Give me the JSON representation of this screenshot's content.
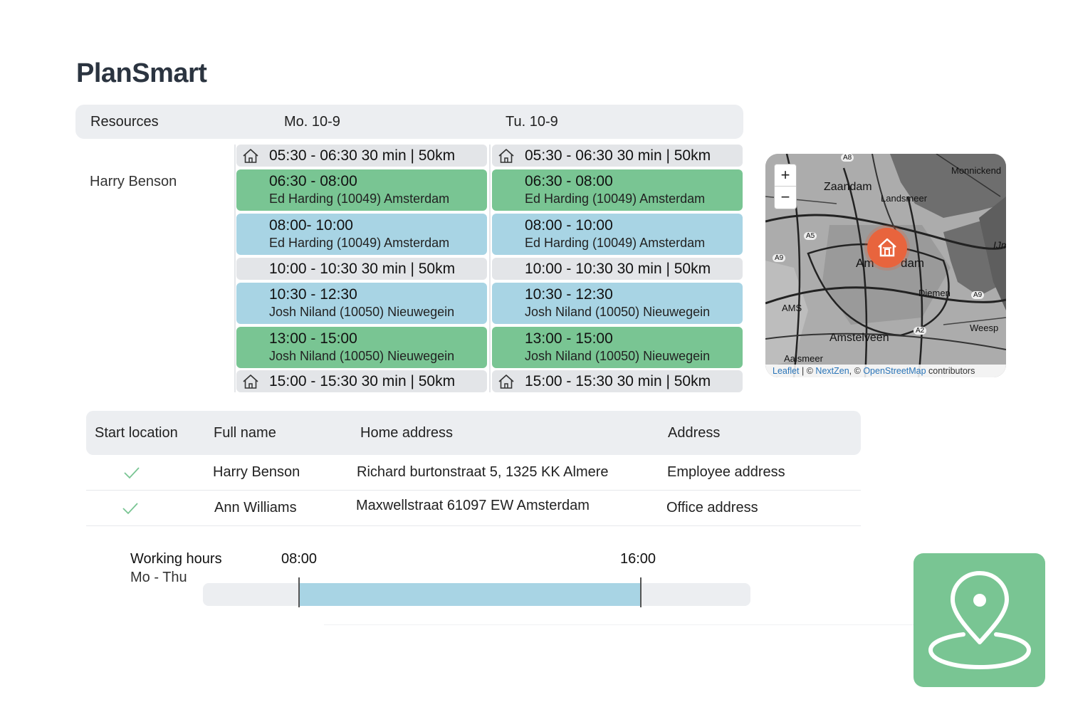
{
  "app": {
    "title": "PlanSmart"
  },
  "schedule": {
    "header": {
      "resources": "Resources",
      "day1": "Mo. 10-9",
      "day2": "Tu. 10-9"
    },
    "resource": "Harry Benson",
    "day1": [
      {
        "type": "travel",
        "home": true,
        "text": "05:30 - 06:30 30 min | 50km"
      },
      {
        "type": "green",
        "time": "06:30 - 08:00",
        "detail": "Ed Harding (10049) Amsterdam"
      },
      {
        "type": "blue",
        "time": "08:00- 10:00",
        "detail": "Ed Harding (10049) Amsterdam"
      },
      {
        "type": "travel",
        "home": false,
        "text": "10:00 - 10:30 30 min | 50km"
      },
      {
        "type": "blue",
        "time": "10:30 - 12:30",
        "detail": "Josh Niland (10050) Nieuwegein"
      },
      {
        "type": "green",
        "time": "13:00 - 15:00",
        "detail": "Josh Niland (10050) Nieuwegein"
      },
      {
        "type": "travel",
        "home": true,
        "text": "15:00 - 15:30 30 min | 50km"
      }
    ],
    "day2": [
      {
        "type": "travel",
        "home": true,
        "text": "05:30 - 06:30 30 min | 50km"
      },
      {
        "type": "green",
        "time": "06:30 - 08:00",
        "detail": "Ed Harding (10049) Amsterdam"
      },
      {
        "type": "blue",
        "time": "08:00 - 10:00",
        "detail": "Ed Harding (10049) Amsterdam"
      },
      {
        "type": "travel",
        "home": false,
        "text": "10:00 - 10:30 30 min | 50km"
      },
      {
        "type": "blue",
        "time": "10:30 - 12:30",
        "detail": "Josh Niland (10050) Nieuwegein"
      },
      {
        "type": "green",
        "time": "13:00 - 15:00",
        "detail": "Josh Niland (10050) Nieuwegein"
      },
      {
        "type": "travel",
        "home": true,
        "text": "15:00 - 15:30 30 min | 50km"
      }
    ]
  },
  "map": {
    "zoom_in": "+",
    "zoom_out": "−",
    "labels": {
      "zaandam": "Zaandam",
      "landsmeer": "Landsmeer",
      "monnickend": "Monnickend",
      "amsterdam_left": "Am",
      "amsterdam_right": "dam",
      "diemen": "Diemen",
      "ams": "AMS",
      "amstelveen": "Amstelveen",
      "weesp": "Weesp",
      "aalsmeer": "Aalsmeer",
      "ijm": "IJm",
      "a8": "A8",
      "a5": "A5",
      "a9_left": "A9",
      "a9_right": "A9",
      "a2": "A2"
    },
    "attribution": {
      "leaflet": "Leaflet",
      "sep": " | © ",
      "nextzen": "NextZen",
      "mid": ", © ",
      "osm": "OpenStreetMap",
      "end": " contributors"
    },
    "pin_icon": "home-icon"
  },
  "table": {
    "headers": [
      "Start location",
      "Full name",
      "Home address",
      "Address"
    ],
    "rows": [
      {
        "start": true,
        "name": "Harry Benson",
        "home": "Richard burtonstraat 5, 1325 KK Almere",
        "address": "Employee address"
      },
      {
        "start": true,
        "name": "Ann Williams",
        "home": "Maxwellstraat 61097 EW Amsterdam",
        "address": "Office address"
      }
    ]
  },
  "working_hours": {
    "label": "Working hours",
    "days": "Mo - Thu",
    "start": "08:00",
    "end": "16:00",
    "start_fraction": 0.176,
    "end_fraction": 0.8
  },
  "colors": {
    "green": "#79c593",
    "blue": "#a8d4e4",
    "travel": "#e3e5e8",
    "pin": "#e8643d"
  },
  "location_card": {
    "icon": "map-pin-icon"
  }
}
